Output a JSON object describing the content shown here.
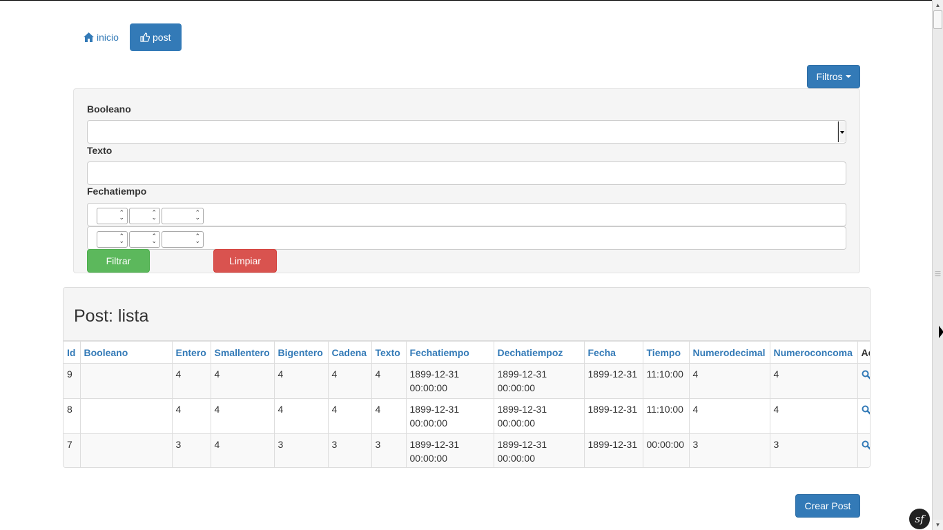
{
  "nav": {
    "home_label": "inicio",
    "post_label": "post"
  },
  "filters_button": {
    "label": "Filtros"
  },
  "filter_form": {
    "booleano_label": "Booleano",
    "booleano_value": "",
    "texto_label": "Texto",
    "texto_value": "",
    "fechatiempo_label": "Fechatiempo",
    "filtrar_label": "Filtrar",
    "limpiar_label": "Limpiar"
  },
  "list": {
    "title": "Post: lista",
    "columns": [
      "Id",
      "Booleano",
      "Entero",
      "Smallentero",
      "Bigentero",
      "Cadena",
      "Texto",
      "Fechatiempo",
      "Dechatiempoz",
      "Fecha",
      "Tiempo",
      "Numerodecimal",
      "Numeroconcoma",
      "Acciones"
    ],
    "rows": [
      {
        "id": "9",
        "booleano": "",
        "entero": "4",
        "smallentero": "4",
        "bigentero": "4",
        "cadena": "4",
        "texto": "4",
        "fechatiempo_date": "1899-12-31",
        "fechatiempo_time": "00:00:00",
        "dechatiempoz_date": "1899-12-31",
        "dechatiempoz_time": "00:00:00",
        "fecha": "1899-12-31",
        "tiempo": "11:10:00",
        "numerodecimal": "4",
        "numeroconcoma": "4"
      },
      {
        "id": "8",
        "booleano": "",
        "entero": "4",
        "smallentero": "4",
        "bigentero": "4",
        "cadena": "4",
        "texto": "4",
        "fechatiempo_date": "1899-12-31",
        "fechatiempo_time": "00:00:00",
        "dechatiempoz_date": "1899-12-31",
        "dechatiempoz_time": "00:00:00",
        "fecha": "1899-12-31",
        "tiempo": "11:10:00",
        "numerodecimal": "4",
        "numeroconcoma": "4"
      },
      {
        "id": "7",
        "booleano": "",
        "entero": "3",
        "smallentero": "4",
        "bigentero": "3",
        "cadena": "3",
        "texto": "3",
        "fechatiempo_date": "1899-12-31",
        "fechatiempo_time": "00:00:00",
        "dechatiempoz_date": "1899-12-31",
        "dechatiempoz_time": "00:00:00",
        "fecha": "1899-12-31",
        "tiempo": "00:00:00",
        "numerodecimal": "3",
        "numeroconcoma": "3"
      }
    ]
  },
  "create_button": {
    "label": "Crear Post"
  },
  "icons": {
    "home": "home-icon",
    "thumbs_up": "thumbs-up-icon",
    "caret": "caret-down-icon",
    "view": "search-icon",
    "edit": "edit-icon",
    "symfony": "symfony-logo-icon"
  },
  "colors": {
    "primary": "#337ab7",
    "success": "#5cb85c",
    "danger": "#d9534f",
    "panel_bg": "#f5f5f5"
  }
}
